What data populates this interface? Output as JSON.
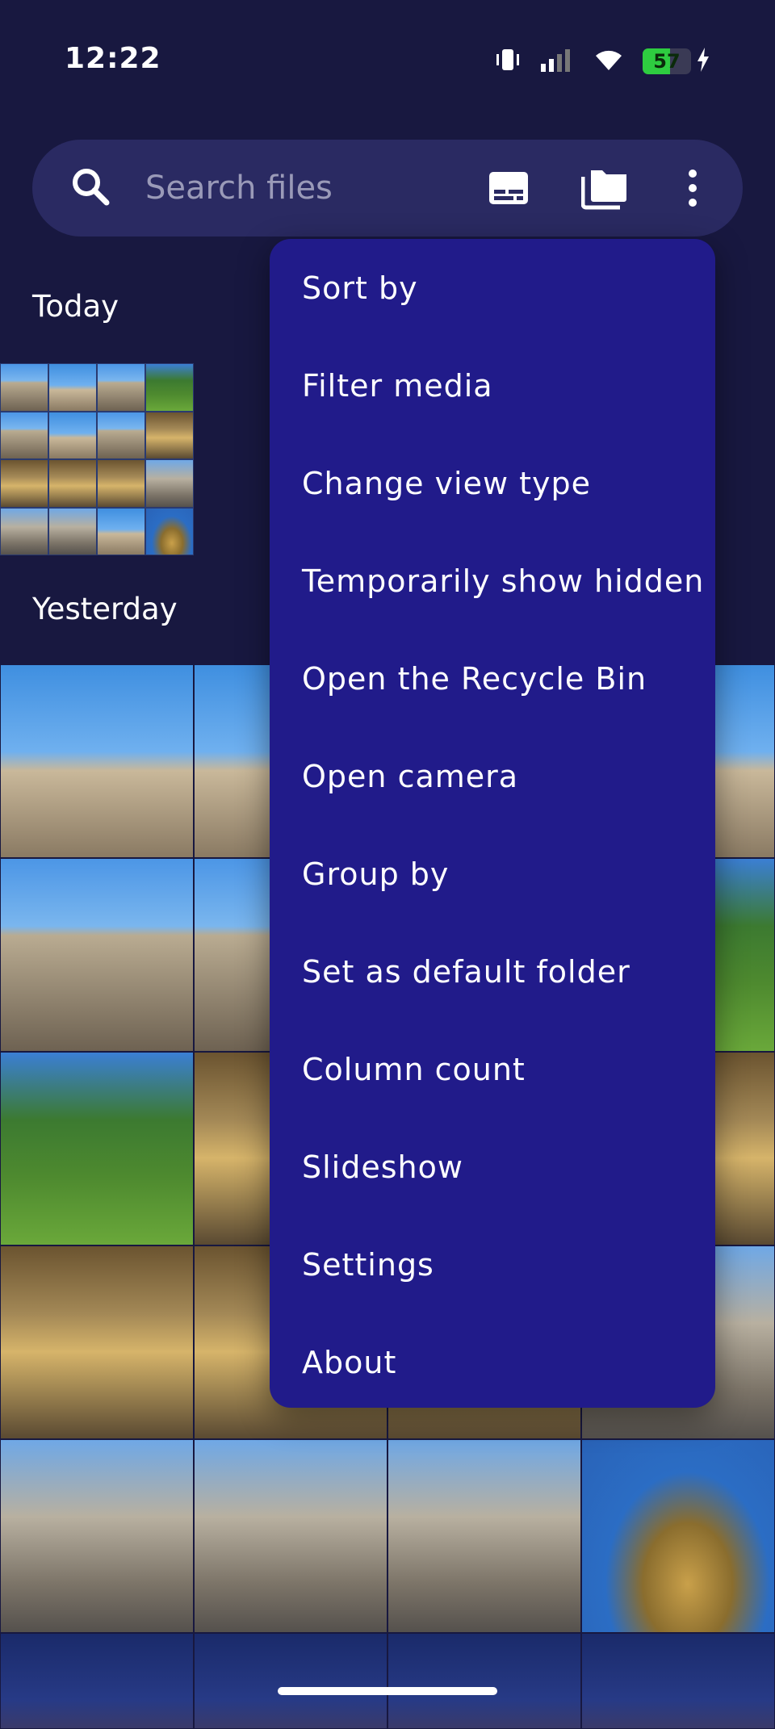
{
  "status_bar": {
    "time": "12:22",
    "battery": "57"
  },
  "search": {
    "placeholder": "Search files"
  },
  "sections": {
    "today": "Today",
    "yesterday": "Yesterday"
  },
  "menu": {
    "items": [
      {
        "label": "Sort by"
      },
      {
        "label": "Filter media"
      },
      {
        "label": "Change view type"
      },
      {
        "label": "Temporarily show hidden"
      },
      {
        "label": "Open the Recycle Bin"
      },
      {
        "label": "Open camera"
      },
      {
        "label": "Group by"
      },
      {
        "label": "Set as default folder"
      },
      {
        "label": "Column count"
      },
      {
        "label": "Slideshow"
      },
      {
        "label": "Settings"
      },
      {
        "label": "About"
      }
    ]
  },
  "colors": {
    "background": "#181840",
    "search_bar": "#2a2a62",
    "menu": "#211b8a",
    "battery_fill": "#2ecc40"
  }
}
